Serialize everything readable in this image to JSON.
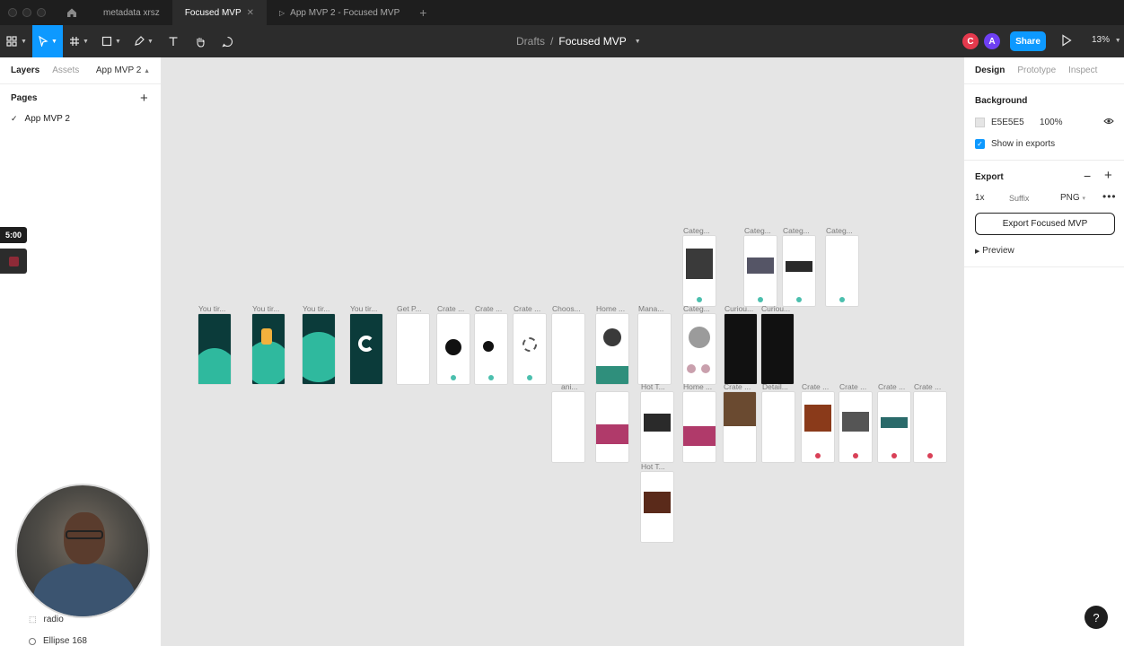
{
  "tabs": [
    {
      "label": "metadata xrsz"
    },
    {
      "label": "Focused MVP"
    },
    {
      "label": "App MVP 2 - Focused MVP"
    }
  ],
  "toolbar": {
    "breadcrumb_root": "Drafts",
    "breadcrumb_sep": "/",
    "file_title": "Focused MVP",
    "avatar_1": "C",
    "avatar_2": "A",
    "share_label": "Share",
    "zoom": "13%"
  },
  "left_panel": {
    "tab_layers": "Layers",
    "tab_assets": "Assets",
    "page_selector": "App MVP 2",
    "pages_heading": "Pages",
    "page_item": "App MVP 2",
    "layers": [
      {
        "label": "radio"
      },
      {
        "label": "Ellipse 168"
      }
    ]
  },
  "timer": "5:00",
  "canvas": {
    "frames": [
      {
        "label": "You tir..."
      },
      {
        "label": "You tir..."
      },
      {
        "label": "You tir..."
      },
      {
        "label": "You tir..."
      },
      {
        "label": "Get P..."
      },
      {
        "label": "Crate ..."
      },
      {
        "label": "Crate ..."
      },
      {
        "label": "Crate ..."
      },
      {
        "label": "Choos..."
      },
      {
        "label": "Home ..."
      },
      {
        "label": "Mana..."
      },
      {
        "label": "Categ..."
      },
      {
        "label": "Categ..."
      },
      {
        "label": "Categ..."
      },
      {
        "label": "Categ..."
      },
      {
        "label": "Categ..."
      },
      {
        "label": "Curiou..."
      },
      {
        "label": "Curiou..."
      },
      {
        "label": "ani..."
      },
      {
        "label": "Hot T..."
      },
      {
        "label": "Home ..."
      },
      {
        "label": "Crate ..."
      },
      {
        "label": "Detail..."
      },
      {
        "label": "Crate ..."
      },
      {
        "label": "Crate ..."
      },
      {
        "label": "Crate ..."
      },
      {
        "label": "Crate ..."
      },
      {
        "label": "Hot T..."
      }
    ]
  },
  "right_panel": {
    "tab_design": "Design",
    "tab_prototype": "Prototype",
    "tab_inspect": "Inspect",
    "background_heading": "Background",
    "bg_hex": "E5E5E5",
    "bg_opacity": "100%",
    "show_in_exports": "Show in exports",
    "export_heading": "Export",
    "export_scale": "1x",
    "export_suffix_placeholder": "Suffix",
    "export_format": "PNG",
    "export_button": "Export Focused MVP",
    "preview_label": "Preview"
  },
  "help_label": "?"
}
